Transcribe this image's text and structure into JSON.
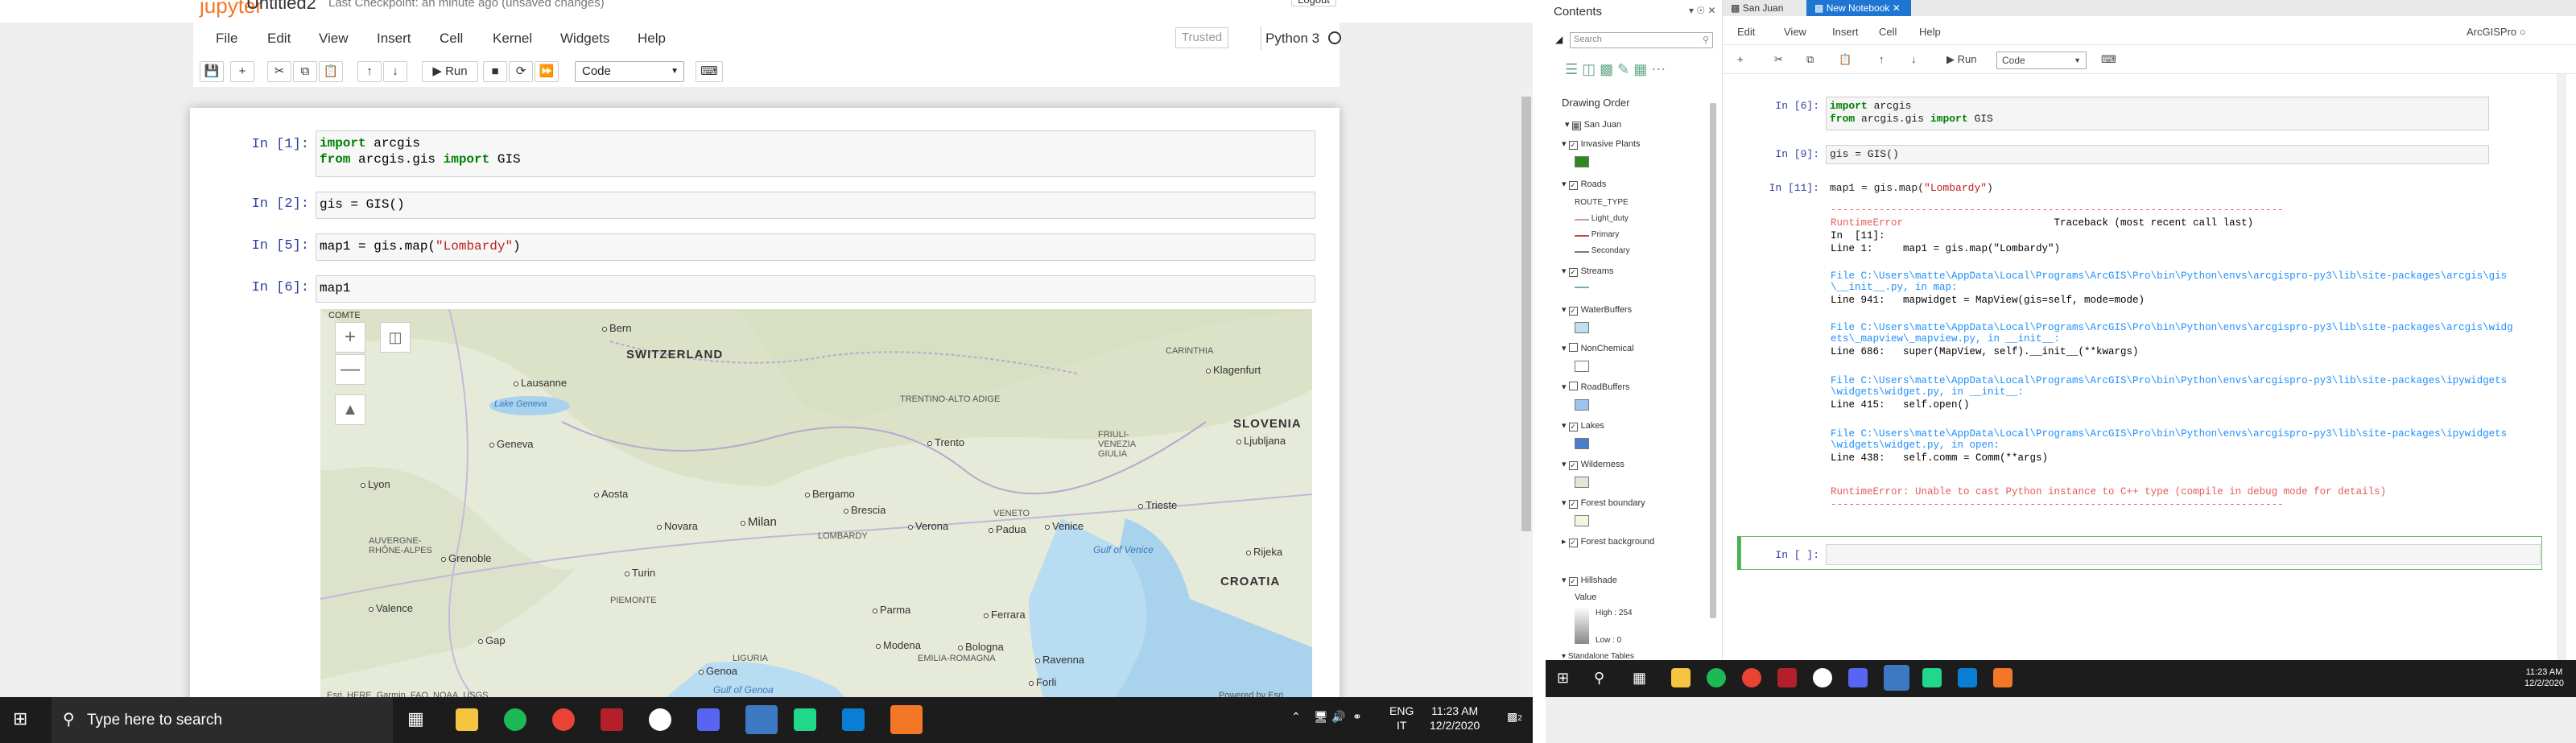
{
  "jupyter": {
    "logo": "jupyter",
    "notebook_name": "Untitled2",
    "checkpoint": "Last Checkpoint: an minute ago (unsaved changes)",
    "logout": "Logout",
    "menu": [
      "File",
      "Edit",
      "View",
      "Insert",
      "Cell",
      "Kernel",
      "Widgets",
      "Help"
    ],
    "trusted": "Trusted",
    "kernel": "Python 3",
    "toolbar": {
      "run": "Run",
      "cell_type": "Code"
    },
    "cells": [
      {
        "prompt": "In [1]:",
        "lines": [
          "import arcgis",
          "from arcgis.gis import GIS"
        ]
      },
      {
        "prompt": "In [2]:",
        "lines": [
          "gis = GIS()"
        ]
      },
      {
        "prompt": "In [5]:",
        "lines": [
          "map1 = gis.map(\"Lombardy\")"
        ]
      },
      {
        "prompt": "In [6]:",
        "lines": [
          "map1"
        ]
      }
    ],
    "map": {
      "attribution": "Esri, HERE, Garmin, FAO, NOAA, USGS",
      "powered": "Powered by Esri",
      "comte": "COMTE",
      "countries": [
        "SWITZERLAND",
        "SLOVENIA",
        "CROATIA"
      ],
      "cities": [
        "Bern",
        "Lausanne",
        "Geneva",
        "Lyon",
        "Grenoble",
        "Valence",
        "Aosta",
        "Turin",
        "Novara",
        "Milan",
        "Bergamo",
        "Brescia",
        "Verona",
        "Padua",
        "Venice",
        "Trieste",
        "Ljubljana",
        "Klagenfurt",
        "Trento",
        "Parma",
        "Modena",
        "Bologna",
        "Ferrara",
        "Ravenna",
        "Genoa",
        "Forli",
        "Rijeka",
        "Gap"
      ],
      "regions": [
        "LOMBARDY",
        "PIEMONTE",
        "VENETO",
        "EMILIA-ROMAGNA",
        "LIGURIA",
        "TRENTINO-ALTO ADIGE",
        "FRIULI-VENEZIA GIULIA",
        "AUVERGNE-RHÔNE-ALPES",
        "CARINTHIA"
      ],
      "seas": [
        "Gulf of Venice",
        "Gulf of Genoa",
        "Lake Geneva"
      ]
    }
  },
  "arcgis": {
    "contents_title": "Contents",
    "search_placeholder": "Search",
    "drawing_order": "Drawing Order",
    "map_name": "San Juan",
    "layers": [
      {
        "name": "Invasive Plants",
        "checked": true,
        "swatch": "#2d8a1e"
      },
      {
        "name": "Roads",
        "checked": true
      },
      {
        "name": "Streams",
        "checked": true
      },
      {
        "name": "WaterBuffers",
        "checked": true,
        "swatch": "#bfe0f0"
      },
      {
        "name": "NonChemical",
        "checked": false,
        "swatch": "#ffffff"
      },
      {
        "name": "RoadBuffers",
        "checked": false,
        "swatch": "#9dc3f0"
      },
      {
        "name": "Lakes",
        "checked": true,
        "swatch": "#4a7ecb"
      },
      {
        "name": "Wilderness",
        "checked": true,
        "swatch": "#e0e8d8"
      },
      {
        "name": "Forest boundary",
        "checked": true,
        "swatch": "#f0f8e0"
      },
      {
        "name": "Forest background",
        "checked": true
      },
      {
        "name": "Hillshade",
        "checked": true
      }
    ],
    "route_type": "ROUTE_TYPE",
    "routes": [
      "Light_duty",
      "Primary",
      "Secondary"
    ],
    "hillshade": {
      "value": "Value",
      "high": "High : 254",
      "low": "Low : 0"
    },
    "standalone": "Standalone Tables",
    "tabs": [
      "San Juan",
      "New Notebook"
    ],
    "menu": [
      "Edit",
      "View",
      "Insert",
      "Cell",
      "Help"
    ],
    "kernel": "ArcGISPro",
    "run": "Run",
    "cell_type": "Code",
    "cells": [
      {
        "prompt": "In [6]:",
        "lines": [
          "import arcgis",
          "from arcgis.gis import GIS"
        ]
      },
      {
        "prompt": "In [9]:",
        "lines": [
          "gis = GIS()"
        ]
      },
      {
        "prompt": "In [11]:",
        "lines": [
          "map1 = gis.map(\"Lombardy\")"
        ]
      },
      {
        "prompt": "In [ ]:",
        "lines": [
          ""
        ]
      }
    ],
    "traceback": {
      "sep": "---------------------------------------------------------------------------",
      "error": "RuntimeError",
      "tb_label": "Traceback (most recent call last)",
      "in_line": "In  [11]:",
      "line1": "Line 1:     map1 = gis.map(\"Lombardy\")",
      "file1": "File C:\\Users\\matte\\AppData\\Local\\Programs\\ArcGIS\\Pro\\bin\\Python\\envs\\arcgispro-py3\\lib\\site-packages\\arcgis\\gis",
      "file1b": "\\__init__.py, in map:",
      "line941": "Line 941:   mapwidget = MapView(gis=self, mode=mode)",
      "file2": "File C:\\Users\\matte\\AppData\\Local\\Programs\\ArcGIS\\Pro\\bin\\Python\\envs\\arcgispro-py3\\lib\\site-packages\\arcgis\\widg",
      "file2b": "ets\\_mapview\\_mapview.py, in __init__:",
      "line686": "Line 686:   super(MapView, self).__init__(**kwargs)",
      "file3": "File C:\\Users\\matte\\AppData\\Local\\Programs\\ArcGIS\\Pro\\bin\\Python\\envs\\arcgispro-py3\\lib\\site-packages\\ipywidgets",
      "file3b": "\\widgets\\widget.py, in __init__:",
      "line415": "Line 415:   self.open()",
      "file4": "File C:\\Users\\matte\\AppData\\Local\\Programs\\ArcGIS\\Pro\\bin\\Python\\envs\\arcgispro-py3\\lib\\site-packages\\ipywidgets",
      "file4b": "\\widgets\\widget.py, in open:",
      "line438": "Line 438:   self.comm = Comm(**args)",
      "final": "RuntimeError: Unable to cast Python instance to C++ type (compile in debug mode for details)"
    }
  },
  "taskbar": {
    "search": "Type here to search",
    "lang1": "ENG",
    "lang2": "IT",
    "time": "11:23 AM",
    "date": "12/2/2020",
    "notif": "2",
    "time2": "11:23 AM",
    "date2": "12/2/2020"
  }
}
